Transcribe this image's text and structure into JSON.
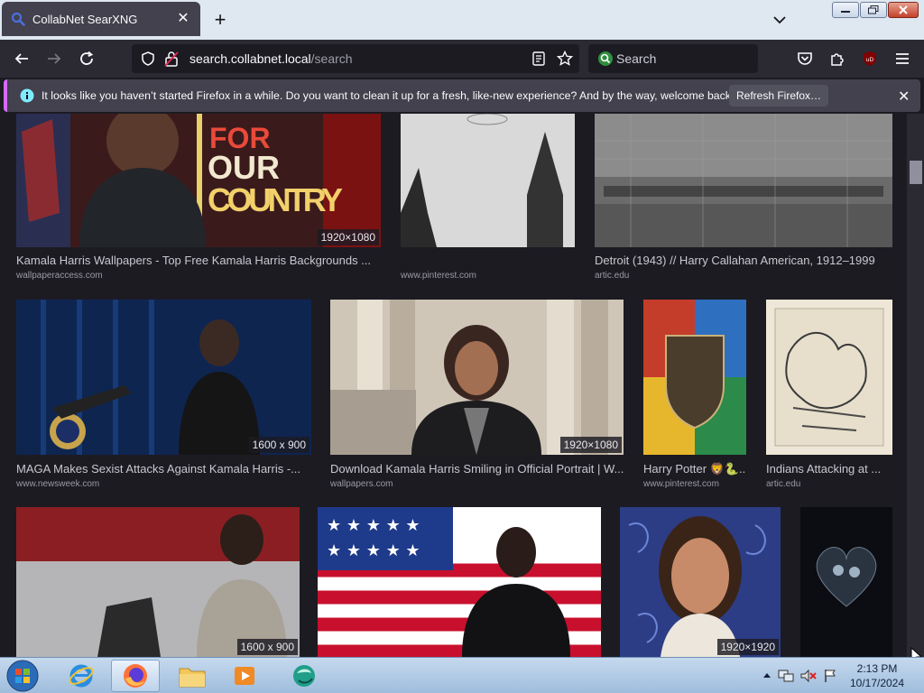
{
  "browser": {
    "tab": {
      "title": "CollabNet SearXNG",
      "close": "✕"
    },
    "new_tab": "+",
    "url": {
      "host": "search.collabnet.local",
      "path": "/search"
    },
    "search_placeholder": "Search"
  },
  "notification": {
    "message": "It looks like you haven’t started Firefox in a while. Do you want to clean it up for a fresh, like-new experience? And by the way, welcome back!",
    "button": "Refresh Firefox…",
    "close": "✕"
  },
  "results": [
    {
      "title": "Kamala Harris Wallpapers - Top Free Kamala Harris Backgrounds ...",
      "url": "wallpaperaccess.com",
      "size": "1920×1080",
      "poster_text": "FOR OUR COUNTRY"
    },
    {
      "title": "",
      "url": "www.pinterest.com",
      "size": ""
    },
    {
      "title": "Detroit (1943) // Harry Callahan American, 1912–1999",
      "url": "artic.edu",
      "size": ""
    },
    {
      "title": "MAGA Makes Sexist Attacks Against Kamala Harris -...",
      "url": "www.newsweek.com",
      "size": "1600 x 900"
    },
    {
      "title": "Download Kamala Harris Smiling in Official Portrait | W...",
      "url": "wallpapers.com",
      "size": "1920×1080"
    },
    {
      "title": "Harry Potter 🦁🐍...",
      "url": "www.pinterest.com",
      "size": ""
    },
    {
      "title": "Indians Attacking at ...",
      "url": "artic.edu",
      "size": ""
    },
    {
      "title": "",
      "url": "",
      "size": "1600 x 900"
    },
    {
      "title": "",
      "url": "",
      "size": ""
    },
    {
      "title": "",
      "url": "",
      "size": "1920×1920"
    },
    {
      "title": "",
      "url": "",
      "size": ""
    }
  ],
  "taskbar": {
    "time": "2:13 PM",
    "date": "10/17/2024"
  }
}
